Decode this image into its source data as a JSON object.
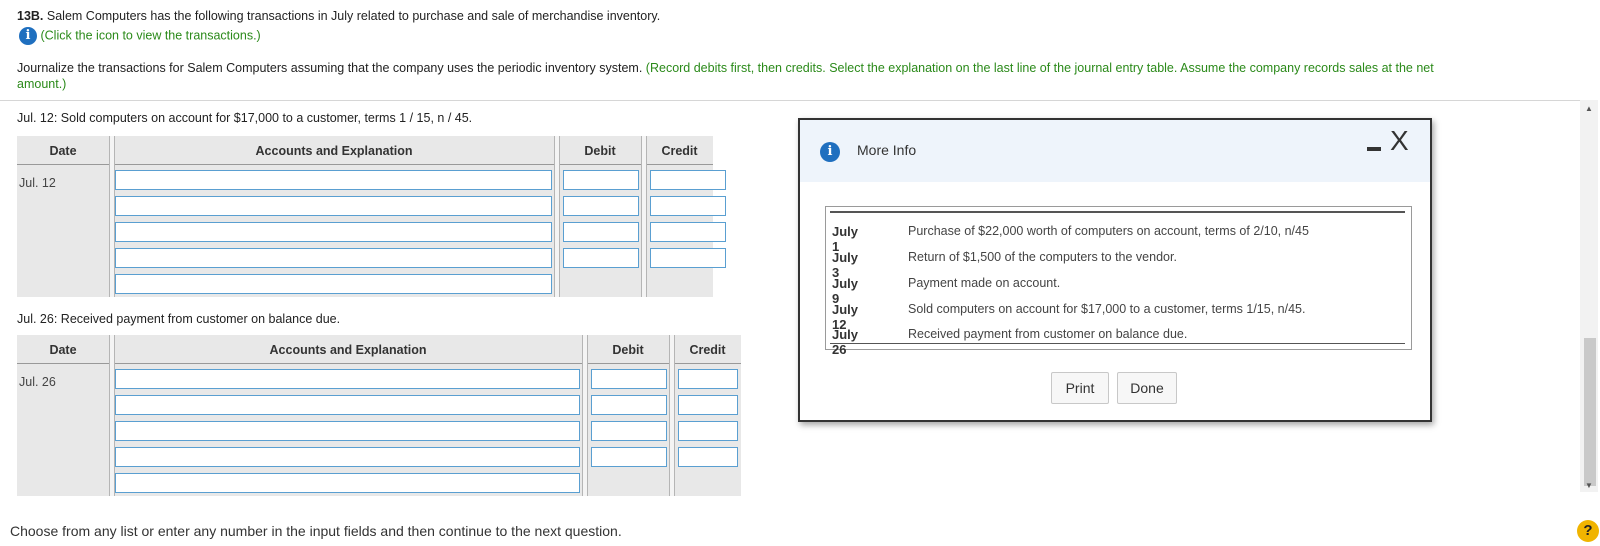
{
  "problem": {
    "number": "13B.",
    "statement": "Salem Computers has the following transactions in July related to purchase and sale of merchandise inventory.",
    "click_link": "(Click the icon to view the transactions.)",
    "instruction_main": "Journalize the transactions for Salem Computers assuming that the company uses the periodic inventory system.",
    "instruction_green_1": "(Record debits first, then credits. Select the explanation on the last line of the journal entry table. Assume the company records sales at the net",
    "instruction_green_2": "amount.)"
  },
  "entry1": {
    "prompt_date": "Jul. 12:",
    "prompt_text": "Sold computers on account for $17,000 to a customer, terms 1 / 15, n / 45.",
    "headers": {
      "date": "Date",
      "accounts": "Accounts and Explanation",
      "debit": "Debit",
      "credit": "Credit"
    },
    "date_label": "Jul. 12"
  },
  "entry2": {
    "prompt_date": "Jul. 26:",
    "prompt_text": "Received payment from customer on balance due.",
    "headers": {
      "date": "Date",
      "accounts": "Accounts and Explanation",
      "debit": "Debit",
      "credit": "Credit"
    },
    "date_label": "Jul. 26"
  },
  "footer": {
    "text": "Choose from any list or enter any number in the input fields and then continue to the next question."
  },
  "modal": {
    "title": "More Info",
    "close_glyph": "X",
    "transactions": [
      {
        "date": "July 1",
        "desc": "Purchase of $22,000 worth of computers on account, terms of 2/10, n/45"
      },
      {
        "date": "July 3",
        "desc": "Return of $1,500 of the computers to the vendor."
      },
      {
        "date": "July 9",
        "desc": "Payment made on account."
      },
      {
        "date": "July 12",
        "desc": "Sold computers on account for $17,000 to a customer, terms 1/15, n/45."
      },
      {
        "date": "July 26",
        "desc": "Received payment from customer on balance due."
      }
    ],
    "print_label": "Print",
    "done_label": "Done"
  },
  "icons": {
    "info": "info-icon",
    "help": "help-icon",
    "minimize": "minimize-icon",
    "close": "close-icon"
  },
  "colors": {
    "accent_blue": "#1f6fbf",
    "instruction_green": "#2b8a1a",
    "input_border": "#5a9fd1",
    "help_yellow": "#f0b400"
  }
}
